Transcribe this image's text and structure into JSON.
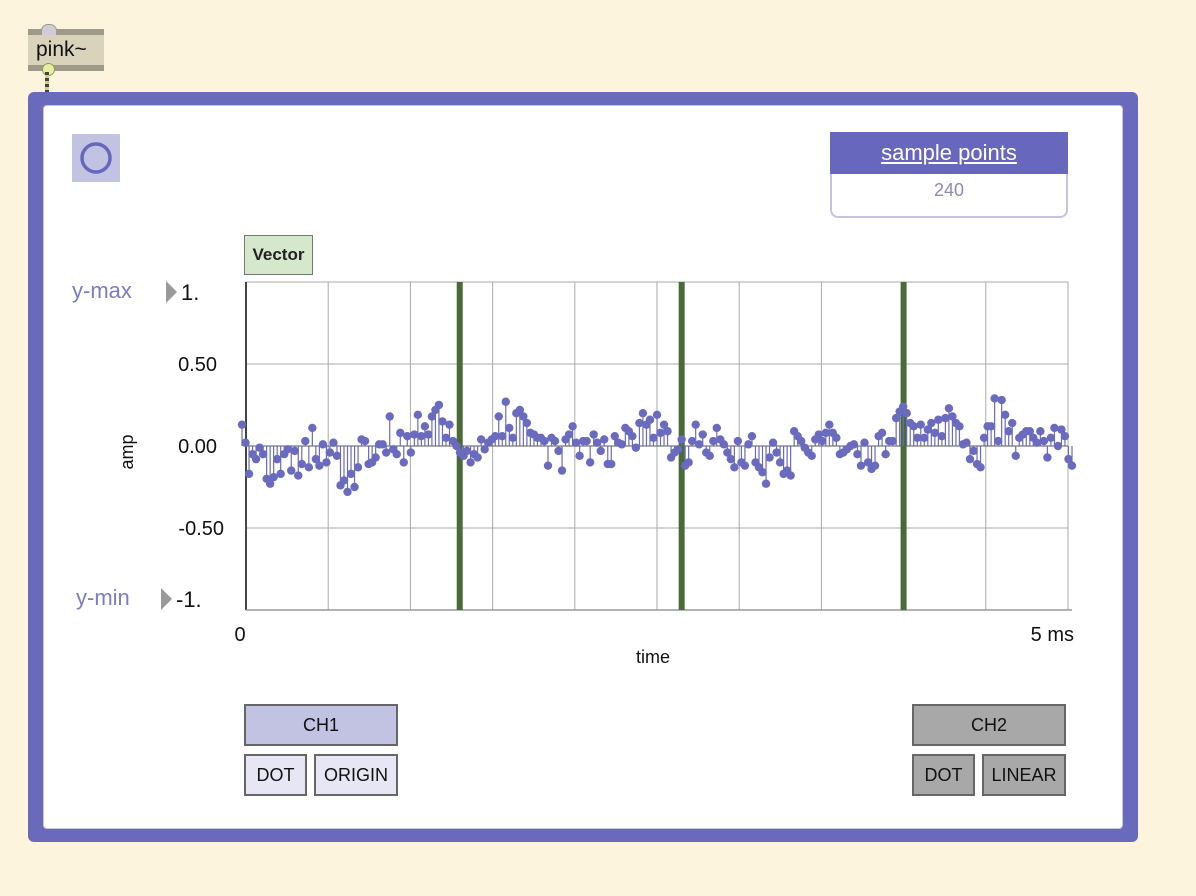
{
  "object": {
    "label": "pink~"
  },
  "scope": {
    "sample_points_label": "sample points",
    "sample_points_value": "240",
    "vector_label": "Vector",
    "ymax_label": "y-max",
    "ymax_value": "1.",
    "ymin_label": "y-min",
    "ymin_value": "-1.",
    "ch1": {
      "label": "CH1",
      "mode": "DOT",
      "draw": "ORIGIN"
    },
    "ch2": {
      "label": "CH2",
      "mode": "DOT",
      "draw": "LINEAR"
    }
  },
  "colors": {
    "accent": "#6767bd",
    "series": "#6a6abf",
    "marker": "#4a6a38",
    "grid": "#aaaaaa"
  },
  "chart_data": {
    "type": "scatter",
    "title": "",
    "xlabel": "time",
    "ylabel": "amp",
    "xlim": [
      0,
      5
    ],
    "ylim": [
      -1,
      1
    ],
    "x_tick_labels": [
      "0",
      "5  ms"
    ],
    "y_tick_labels": [
      "1.",
      "0.50",
      "0.00",
      "-0.50",
      "-1."
    ],
    "grid": true,
    "vertical_markers": [
      1.3,
      2.65,
      4.0
    ],
    "series": [
      {
        "values": [
          0.13,
          0.02,
          -0.17,
          -0.05,
          -0.08,
          -0.01,
          -0.05,
          -0.2,
          -0.23,
          -0.19,
          -0.08,
          -0.17,
          -0.05,
          -0.02,
          -0.15,
          -0.03,
          -0.18,
          -0.11,
          0.03,
          -0.13,
          0.11,
          -0.08,
          -0.12,
          0.01,
          -0.1,
          -0.04,
          0.02,
          -0.06,
          -0.24,
          -0.21,
          -0.28,
          -0.17,
          -0.25,
          -0.13,
          0.04,
          0.03,
          -0.11,
          -0.1,
          -0.07,
          0.01,
          0.01,
          -0.04,
          0.18,
          -0.02,
          -0.05,
          0.08,
          -0.1,
          0.06,
          -0.04,
          0.07,
          0.19,
          0.06,
          0.12,
          0.07,
          0.18,
          0.22,
          0.25,
          0.15,
          0.05,
          0.13,
          0.03,
          0.0,
          -0.04,
          -0.06,
          -0.03,
          -0.1,
          -0.05,
          -0.07,
          0.04,
          -0.02,
          0.02,
          0.04,
          0.06,
          0.18,
          0.06,
          0.27,
          0.11,
          0.05,
          0.2,
          0.22,
          0.18,
          0.14,
          0.08,
          0.07,
          0.05,
          0.05,
          0.03,
          -0.12,
          0.05,
          0.03,
          -0.03,
          -0.15,
          0.04,
          0.07,
          0.12,
          0.02,
          -0.06,
          0.03,
          0.03,
          -0.1,
          0.07,
          0.02,
          -0.03,
          0.04,
          -0.11,
          -0.11,
          0.06,
          0.02,
          0.01,
          0.11,
          0.09,
          0.06,
          -0.01,
          0.14,
          0.2,
          0.13,
          0.16,
          0.05,
          0.19,
          0.08,
          0.13,
          0.09,
          -0.07,
          -0.04,
          -0.02,
          0.04,
          -0.12,
          -0.1,
          0.03,
          0.13,
          0.01,
          0.07,
          -0.04,
          -0.06,
          0.03,
          0.11,
          0.04,
          0.01,
          -0.04,
          -0.08,
          -0.13,
          0.03,
          -0.1,
          -0.12,
          0.01,
          0.06,
          -0.1,
          -0.13,
          -0.16,
          -0.23,
          -0.07,
          0.02,
          -0.04,
          -0.1,
          -0.17,
          -0.15,
          -0.18,
          0.09,
          0.06,
          0.03,
          -0.01,
          -0.04,
          -0.06,
          0.04,
          0.07,
          0.03,
          0.08,
          0.13,
          0.08,
          0.05,
          -0.05,
          -0.04,
          -0.02,
          0.0,
          0.01,
          -0.05,
          -0.12,
          0.02,
          -0.1,
          -0.14,
          -0.12,
          0.06,
          0.08,
          -0.05,
          0.03,
          0.03,
          0.17,
          0.21,
          0.24,
          0.2,
          0.14,
          0.12,
          0.05,
          0.13,
          0.05,
          0.1,
          0.14,
          0.08,
          0.16,
          0.06,
          0.17,
          0.23,
          0.18,
          0.14,
          0.12,
          0.01,
          0.02,
          -0.08,
          -0.03,
          -0.11,
          -0.13,
          0.05,
          0.12,
          0.12,
          0.29,
          0.03,
          0.28,
          0.19,
          0.09,
          0.14,
          -0.06,
          0.05,
          0.07,
          0.09,
          0.09,
          0.05,
          0.02,
          0.09,
          0.03,
          -0.07,
          0.05,
          0.11,
          0.0,
          0.1,
          0.06,
          -0.08,
          -0.12
        ]
      }
    ]
  }
}
